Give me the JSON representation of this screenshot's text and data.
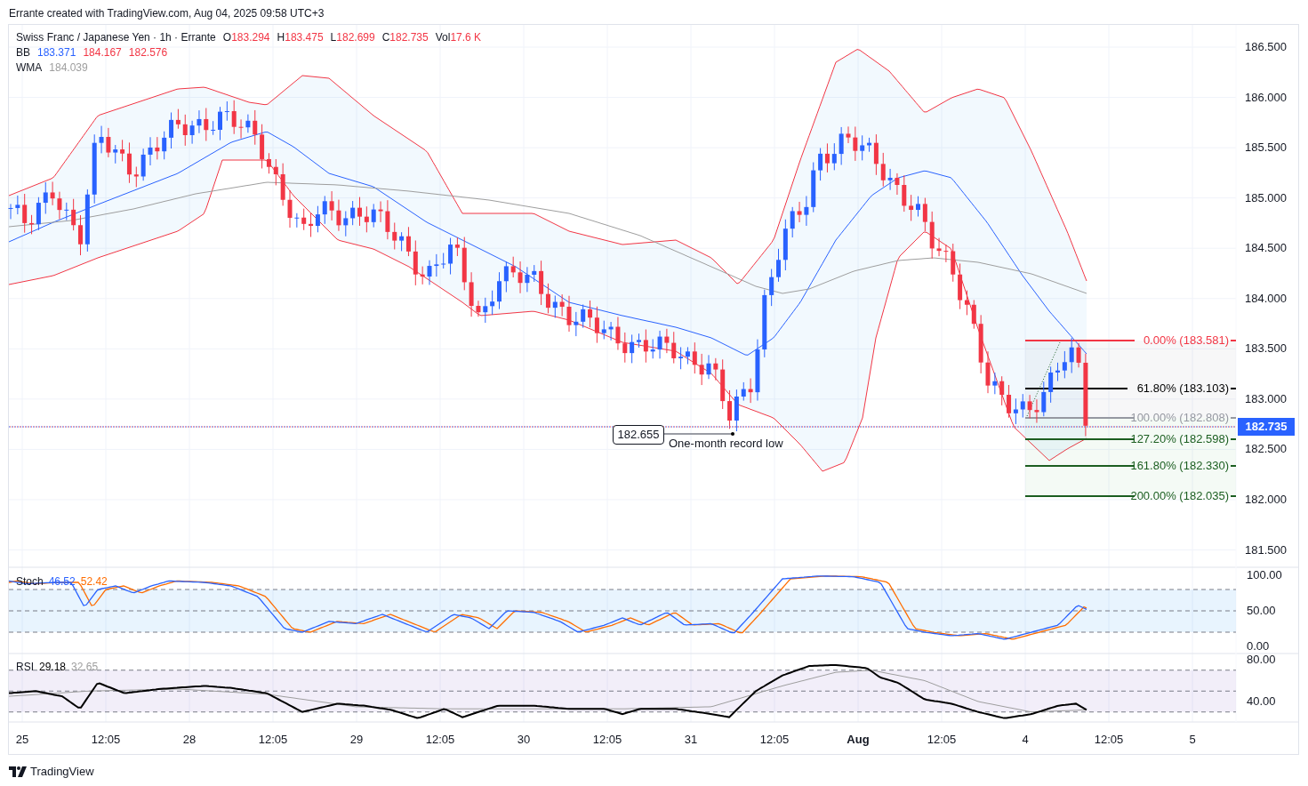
{
  "caption": "Errante created with TradingView.com, Aug 04, 2025 09:58 UTC+3",
  "legend": {
    "symbol": "Swiss Franc / Japanese Yen · 1h · Errante",
    "ohlc": [
      {
        "label": "O",
        "value": "183.294"
      },
      {
        "label": "H",
        "value": "183.475"
      },
      {
        "label": "L",
        "value": "182.699"
      },
      {
        "label": "C",
        "value": "182.735"
      },
      {
        "label": "Vol",
        "value": "17.6 K"
      }
    ],
    "bb": {
      "label": "BB",
      "values": [
        {
          "value": "183.371",
          "color": "#2962ff"
        },
        {
          "value": "184.167",
          "color": "#f23645"
        },
        {
          "value": "182.576",
          "color": "#f23645"
        }
      ]
    },
    "wma": {
      "label": "WMA",
      "value": "184.039"
    }
  },
  "price_axis": [
    "186.500",
    "186.000",
    "185.500",
    "185.000",
    "184.500",
    "184.000",
    "183.500",
    "183.000",
    "182.500",
    "182.000",
    "181.500"
  ],
  "current_price": "182.735",
  "fib_levels": [
    {
      "label": "0.00% (183.581)",
      "color": "#f23645"
    },
    {
      "label": "61.80% (183.103)",
      "color": "#000000"
    },
    {
      "label": "100.00% (182.808)",
      "color": "#9598a1"
    },
    {
      "label": "127.20% (182.598)",
      "color": "#1b5e20"
    },
    {
      "label": "161.80% (182.330)",
      "color": "#1b5e20"
    },
    {
      "label": "200.00% (182.035)",
      "color": "#1b5e20"
    }
  ],
  "annotation": {
    "price": "182.655",
    "note": "One-month record low"
  },
  "stoch": {
    "label": "Stoch",
    "k": "46.52",
    "d": "52.42",
    "axis": [
      "100.00",
      "50.00",
      "0.00"
    ]
  },
  "rsi": {
    "label": "RSI",
    "value": "29.18",
    "signal": "32.65",
    "axis": [
      "80.00",
      "40.00"
    ]
  },
  "time_axis": [
    {
      "label": "25",
      "emphasized": false
    },
    {
      "label": "12:05",
      "emphasized": false
    },
    {
      "label": "28",
      "emphasized": false
    },
    {
      "label": "12:05",
      "emphasized": false
    },
    {
      "label": "29",
      "emphasized": false
    },
    {
      "label": "12:05",
      "emphasized": false
    },
    {
      "label": "30",
      "emphasized": false
    },
    {
      "label": "12:05",
      "emphasized": false
    },
    {
      "label": "31",
      "emphasized": false
    },
    {
      "label": "12:05",
      "emphasized": false
    },
    {
      "label": "Aug",
      "emphasized": true
    },
    {
      "label": "12:05",
      "emphasized": false
    },
    {
      "label": "4",
      "emphasized": false
    },
    {
      "label": "12:05",
      "emphasized": false
    },
    {
      "label": "5",
      "emphasized": false
    }
  ],
  "footer": "TradingView"
}
